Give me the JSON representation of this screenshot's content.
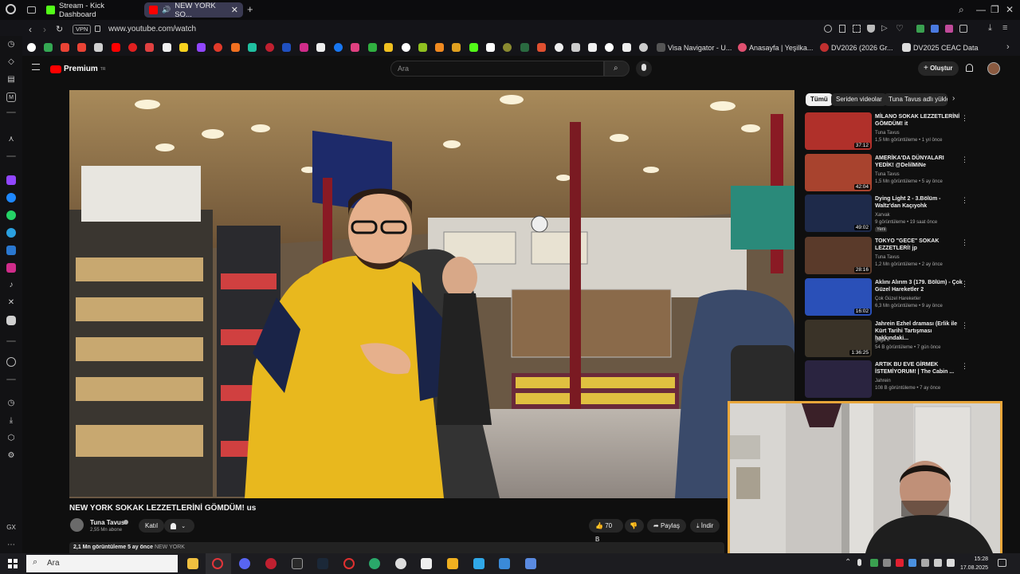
{
  "browser": {
    "tabs": [
      {
        "label": "Stream - Kick Dashboard"
      },
      {
        "label": "NEW YORK SO..."
      }
    ],
    "vpn_label": "VPN",
    "url": "www.youtube.com/watch",
    "bookmarks": [
      {
        "label": "Visa Navigator - U..."
      },
      {
        "label": "Anasayfa | Yeşilka..."
      },
      {
        "label": "DV2026 (2026 Gr..."
      },
      {
        "label": "DV2025 CEAC Data"
      }
    ]
  },
  "youtube": {
    "logo_text": "Premium",
    "logo_sup": "TR",
    "search_placeholder": "Ara",
    "create_label": "Oluştur",
    "chips": [
      "Tümü",
      "Seriden videolar",
      "Tuna Tavus adlı yükle"
    ],
    "video": {
      "title": "NEW YORK SOKAK LEZZETLERİNİ GÖMDÜM! us",
      "channel": "Tuna Tavus",
      "subscribers": "2,55 Mn abone",
      "join_label": "Katıl",
      "likes": "70 B",
      "share_label": "Paylaş",
      "download_label": "İndir",
      "views": "2,1 Mn görüntüleme",
      "age": "5 ay önce",
      "tag": "NEW YORK"
    },
    "recommended": [
      {
        "title": "MİLANO SOKAK LEZZETLERİNİ GÖMDÜM! it",
        "channel": "Tuna Tavus",
        "meta": "1,5 Mn görüntüleme • 1 yıl önce",
        "duration": "37:12",
        "color": "#b0302a"
      },
      {
        "title": "AMERİKA'DA DÜNYALARI YEDİK! @DelilMiNe",
        "channel": "Tuna Tavus",
        "meta": "1,5 Mn görüntüleme • 5 ay önce",
        "duration": "42:04",
        "color": "#a8432e"
      },
      {
        "title": "Dying Light 2 - 3.Bölüm - Waltz'dan Kaçıyohk",
        "channel": "Xarvak",
        "meta": "9 görüntüleme • 19 saat önce",
        "duration": "49:02",
        "color": "#1e2a4a",
        "badge": "Yeni"
      },
      {
        "title": "TOKYO \"GECE\" SOKAK LEZZETLERİ! jp",
        "channel": "Tuna Tavus",
        "meta": "1,2 Mn görüntüleme • 2 ay önce",
        "duration": "28:16",
        "color": "#5a3a2a"
      },
      {
        "title": "Aklını Alırım 3 (179. Bölüm) - Çok Güzel Hareketler 2",
        "channel": "Çok Güzel Hareketler",
        "meta": "6,3 Mn görüntüleme • 9 ay önce",
        "duration": "16:02",
        "color": "#2a50b8"
      },
      {
        "title": "Jahrein Ezhel draması (Erlik ile Kürt Tarihi Tartışması hakkındaki...",
        "channel": "gaga x",
        "meta": "54 B görüntüleme • 7 gün önce",
        "duration": "1:36:25",
        "color": "#3a3328"
      },
      {
        "title": "ARTIK BU EVE GİRMEK İSTEMİYORUM! | The Cabin ...",
        "channel": "Jahrein",
        "meta": "108 B görüntüleme • 7 ay önce",
        "duration": "",
        "color": "#2a2440"
      }
    ]
  },
  "taskbar": {
    "search_label": "Ara",
    "clock_time": "15:28",
    "clock_date": "17.08.2025"
  }
}
